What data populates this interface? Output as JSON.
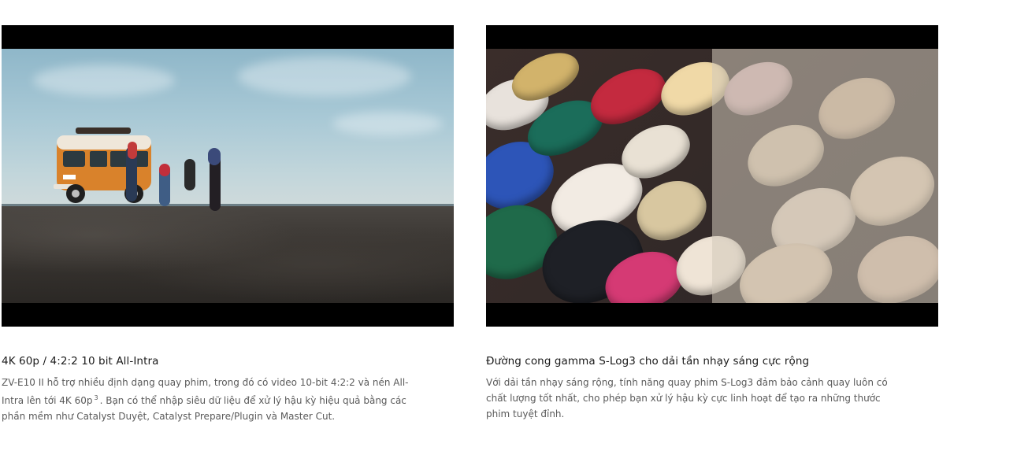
{
  "features": [
    {
      "image_alt": "Xe van cam trên cao nguyên cùng nhóm người",
      "title": "4K 60p / 4:2:2 10 bit All-Intra",
      "desc_before": "ZV-E10 II hỗ trợ nhiều định dạng quay phim, trong đó có video 10-bit 4:2:2 và nén All-Intra lên tới 4K 60p",
      "footnote": "3",
      "desc_after": ". Bạn có thể nhập siêu dữ liệu để xử lý hậu kỳ hiệu quả bằng các phần mềm như Catalyst Duyệt, Catalyst Prepare/Plugin và Master Cut."
    },
    {
      "image_alt": "Giày thêu nhiều màu, một nửa ở dạng S-Log3",
      "title": "Đường cong gamma S-Log3 cho dải tần nhạy sáng cực rộng",
      "desc": "Với dải tần nhạy sáng rộng, tính năng quay phim S-Log3 đảm bảo cảnh quay luôn có chất lượng tốt nhất, cho phép bạn xử lý hậu kỳ cực linh hoạt để tạo ra những thước phim tuyệt đỉnh."
    }
  ],
  "colors": {
    "letterbox": "#000000",
    "title": "#1a1a1a",
    "body": "#5a5a5a",
    "van": "#d9822b"
  }
}
